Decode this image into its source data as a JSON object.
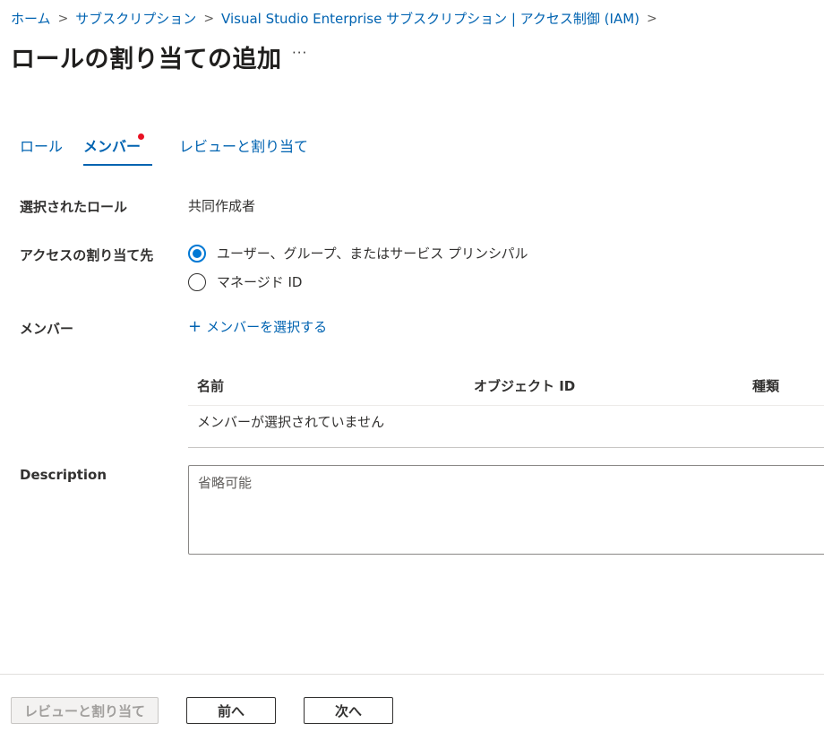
{
  "breadcrumb": {
    "items": [
      "ホーム",
      "サブスクリプション",
      "Visual Studio Enterprise サブスクリプション | アクセス制御 (IAM)"
    ],
    "separator": ">"
  },
  "page": {
    "title": "ロールの割り当ての追加",
    "more": "···"
  },
  "tabs": [
    {
      "label": "ロール",
      "active": false
    },
    {
      "label": "メンバー",
      "active": true,
      "has_indicator": true
    },
    {
      "label": "レビューと割り当て",
      "active": false
    }
  ],
  "form": {
    "selected_role": {
      "label": "選択されたロール",
      "value": "共同作成者"
    },
    "assign_access": {
      "label": "アクセスの割り当て先",
      "options": [
        {
          "label": "ユーザー、グループ、またはサービス プリンシパル",
          "checked": true
        },
        {
          "label": "マネージド ID",
          "checked": false
        }
      ]
    },
    "members": {
      "label": "メンバー",
      "add_link": "メンバーを選択する",
      "table": {
        "columns": [
          "名前",
          "オブジェクト ID",
          "種類"
        ],
        "empty_message": "メンバーが選択されていません"
      }
    },
    "description": {
      "label": "Description",
      "placeholder": "省略可能",
      "value": ""
    }
  },
  "footer": {
    "review_button": "レビューと割り当て",
    "prev_button": "前へ",
    "next_button": "次へ"
  },
  "colors": {
    "accent": "#0078d4",
    "link": "#0063b1",
    "indicator": "#e81123"
  }
}
